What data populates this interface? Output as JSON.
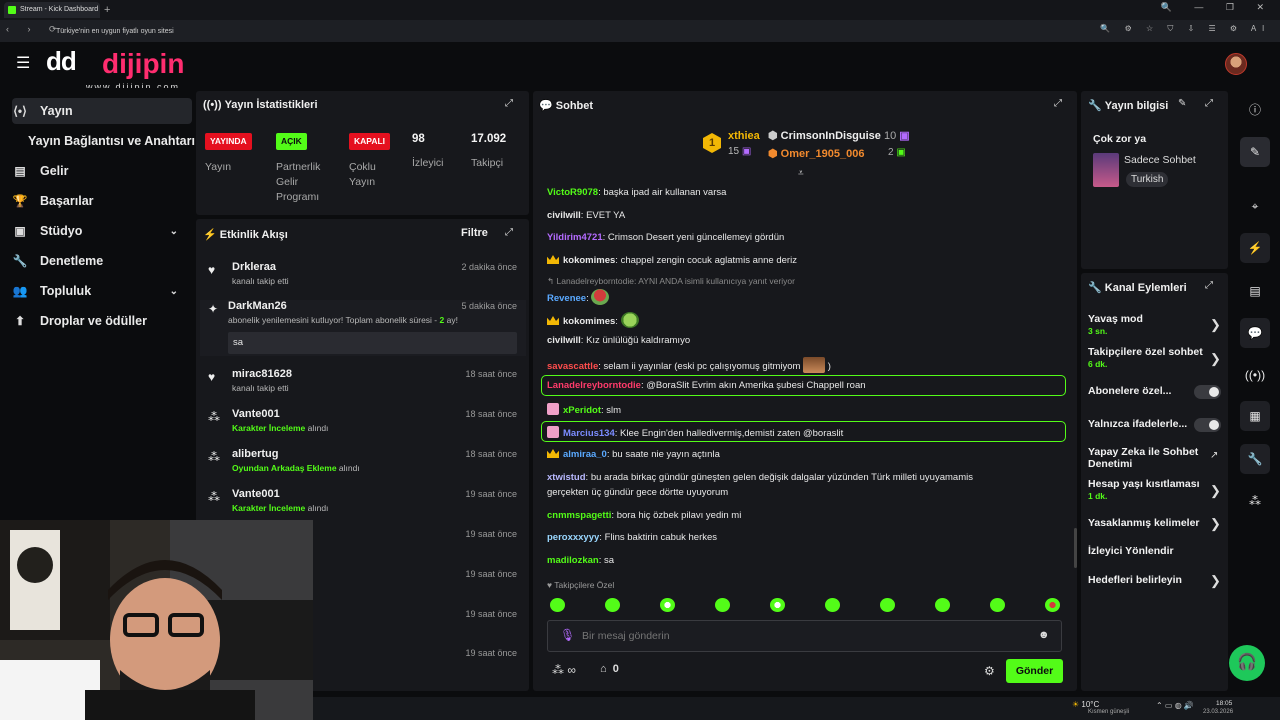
{
  "browser": {
    "tab_title": "Stream - Kick Dashboard",
    "new_tab": "+",
    "url": "Türkiye'nin en uygun fiyatlı oyun sitesi",
    "window_controls": "🔍 — ❐ ✕",
    "nav": "‹ › ⟳",
    "addr_icons": "🔍 ⚙ ☆ ⛉ ⇩ ☰ ⚙ Al"
  },
  "brand": {
    "mark": "dd",
    "name": "dijipin",
    "site": "www.dijipin.com"
  },
  "sidebar": {
    "items": [
      {
        "label": "Yayın",
        "icon": "⟨•⟩"
      },
      {
        "label": "Yayın Bağlantısı ve Anahtarı",
        "icon": ""
      },
      {
        "label": "Gelir",
        "icon": "▤"
      },
      {
        "label": "Başarılar",
        "icon": "🏆"
      },
      {
        "label": "Stüdyo",
        "icon": "▣"
      },
      {
        "label": "Denetleme",
        "icon": "🔧"
      },
      {
        "label": "Topluluk",
        "icon": "👥"
      },
      {
        "label": "Droplar ve ödüller",
        "icon": "⬆"
      }
    ],
    "chevron": "⌄"
  },
  "stats": {
    "title": "Yayın İstatistikleri",
    "badges": [
      {
        "text": "YAYINDA",
        "label": "Yayın"
      },
      {
        "text": "AÇIK",
        "label": "Partnerlik Gelir Programı"
      },
      {
        "text": "KAPALI",
        "label": "Çoklu Yayın"
      }
    ],
    "viewers": {
      "value": "98",
      "label": "İzleyici"
    },
    "followers": {
      "value": "17.092",
      "label": "Takipçi"
    },
    "colors": {
      "live": "#e5101f",
      "on": "#53fc18",
      "off": "#e5101f"
    }
  },
  "activity": {
    "title": "Etkinlik Akışı",
    "filter": "Filtre",
    "items": [
      {
        "name": "Drkleraa",
        "time": "2 dakika önce",
        "sub": "kanalı takip etti",
        "icon": "heart-icon"
      },
      {
        "name": "DarkMan26",
        "time": "5 dakika önce",
        "sub": "abonelik yenilemesini kutluyor! Toplam abonelik süresi - ",
        "sub_strong": "2",
        "sub_tail": " ay!",
        "message": "sa",
        "icon": "star-icon"
      },
      {
        "name": "mirac81628",
        "time": "18 saat önce",
        "sub": "kanalı takip etti",
        "icon": "heart-icon"
      },
      {
        "name": "Vante001",
        "time": "18 saat önce",
        "sub_strong": "Karakter İnceleme",
        "sub_tail": " alındı",
        "icon": "points-icon"
      },
      {
        "name": "alibertug",
        "time": "18 saat önce",
        "sub_strong": "Oyundan Arkadaş Ekleme",
        "sub_tail": " alındı",
        "icon": "points-icon"
      },
      {
        "name": "Vante001",
        "time": "19 saat önce",
        "sub_strong": "Karakter İnceleme",
        "sub_tail": " alındı",
        "icon": "points-icon"
      }
    ],
    "hidden_times": [
      "19 saat önce",
      "19 saat önce",
      "19 saat önce",
      "19 saat önce"
    ]
  },
  "chat": {
    "title": "Sohbet",
    "leaderboard": {
      "rank": "1",
      "first": {
        "name": "xthiea",
        "count": "15"
      },
      "second": {
        "name": "CrimsonInDisguise",
        "count": "10"
      },
      "third": {
        "name": "Omer_1905_006",
        "count": "2"
      }
    },
    "messages": [
      {
        "user": "VictoR9078",
        "color": "#53fc18",
        "text": "başka ipad air kullanan varsa"
      },
      {
        "user": "civilwill",
        "color": "#e8e8e8",
        "text": "EVET YA"
      },
      {
        "user": "Yildirim4721",
        "color": "#b46bff",
        "text": "Crimson Desert yeni güncellemeyi gördün"
      },
      {
        "user": "kokomimes",
        "color": "#e8e8e8",
        "text": "chappel zengin cocuk aglatmis anne deriz"
      },
      {
        "reply": "Lanadelreyborntodie: AYNI ANDA isimli kullanıcıya yanıt veriyor"
      },
      {
        "user": "Revenee",
        "color": "#5aa9ff",
        "text": ""
      },
      {
        "user": "kokomimes",
        "color": "#e8e8e8",
        "text": ""
      },
      {
        "user": "civilwill",
        "color": "#e8e8e8",
        "text": "Kız ünlülüğü kaldıramıyo"
      },
      {
        "user": "savascattle",
        "color": "#ff4d4d",
        "text": "selam ii yayınlar (eski pc çalışıyomuş gitmiyom",
        "tail": ")"
      },
      {
        "user": "Lanadelreyborntodie",
        "color": "#ff3b6b",
        "text": "@BoraSlit Evrim akın Amerika şubesi Chappell roan"
      },
      {
        "user": "xPeridot",
        "color": "#53fc18",
        "text": "slm"
      },
      {
        "user": "Marcius134",
        "color": "#7b8cff",
        "text": "Klee Engin'den halledivermiş,demisti zaten @boraslit"
      },
      {
        "user": "almiraa_0",
        "color": "#5aa9ff",
        "text": "bu saate nie yayın açtınla"
      },
      {
        "user": "xtwistud",
        "color": "#b9b9ff",
        "text": "bu arada birkaç gündür güneşten gelen değişik dalgalar yüzünden Türk milleti uyuyamamis"
      },
      {
        "continuation": "gerçekten üç gündür gece dörtte uyuyorum"
      },
      {
        "user": "cnmmspagetti",
        "color": "#53fc18",
        "text": "bora hiç özbek pilavı yedin mi"
      },
      {
        "user": "peroxxxyyy",
        "color": "#9ad7ff",
        "text": "Flins baktirin cabuk herkes"
      },
      {
        "user": "madilozkan",
        "color": "#53fc18",
        "text": "sa"
      }
    ],
    "followers_only": "Takipçilere Özel",
    "input_placeholder": "Bir mesaj gönderin",
    "infinity": "∞",
    "store_count": "0",
    "send": "Gönder"
  },
  "stream_info": {
    "title": "Yayın bilgisi",
    "stream_title": "Çok zor ya",
    "category": "Sadece Sohbet",
    "language": "Turkish"
  },
  "channel_actions": {
    "title": "Kanal Eylemleri",
    "items": [
      {
        "label": "Yavaş mod",
        "sub": "3 sn."
      },
      {
        "label": "Takipçilere özel sohbet",
        "sub": "6 dk."
      },
      {
        "label": "Abonelere özel..."
      },
      {
        "label": "Yalnızca ifadelerle..."
      },
      {
        "label": "Yapay Zeka ile Sohbet",
        "label2": "Denetimi"
      },
      {
        "label": "Hesap yaşı kısıtlaması",
        "sub": "1 dk."
      },
      {
        "label": "Yasaklanmış kelimeler"
      },
      {
        "label": "İzleyici Yönlendir"
      },
      {
        "label": "Hedefleri belirleyin"
      }
    ]
  },
  "taskbar": {
    "weather": "10°C",
    "weather_sub": "Kısmen güneşli",
    "time": "18:05",
    "date": "23.03.2026"
  }
}
